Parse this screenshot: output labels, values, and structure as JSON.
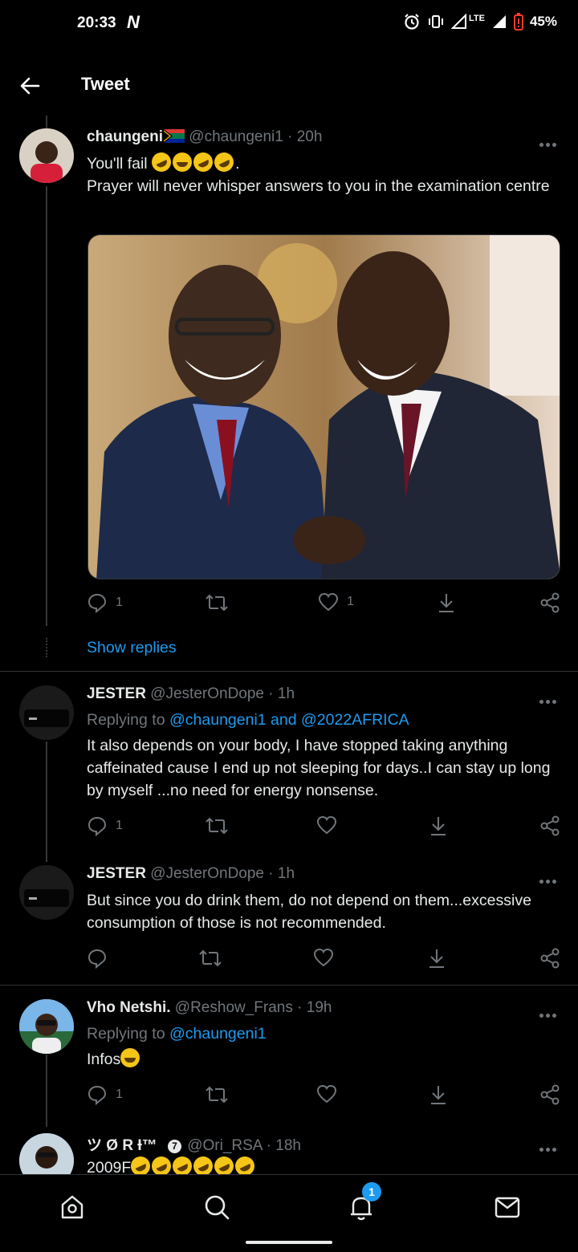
{
  "status_bar": {
    "time": "20:33",
    "carrier_glyph": "N",
    "network": "LTE",
    "battery": "45%"
  },
  "header": {
    "title": "Tweet"
  },
  "tweets": [
    {
      "name": "chaungeni",
      "handle": "@chaungeni1",
      "time": "· 20h",
      "text_line1_prefix": "You'll fail ",
      "text_line1_suffix": ".",
      "text_line2": "Prayer will never whisper answers to you in the examination centre",
      "replies": "1",
      "likes": "1"
    },
    {
      "name": "JESTER",
      "handle": "@JesterOnDope",
      "time": "· 1h",
      "replying_prefix": "Replying to ",
      "replying_to": "@chaungeni1 and @2022AFRICA",
      "text": "It also depends on your body, I have stopped taking anything caffeinated cause  I end up not sleeping for days..I can stay up long by myself ...no need for energy nonsense.",
      "replies": "1"
    },
    {
      "name": "JESTER",
      "handle": "@JesterOnDope",
      "time": "· 1h",
      "text": "But since you do drink them, do not depend on them...excessive consumption of those is not recommended."
    },
    {
      "name": "Vho Netshi.",
      "handle": "@Reshow_Frans",
      "time": "· 19h",
      "replying_prefix": "Replying to ",
      "replying_to": "@chaungeni1",
      "text": "Infos",
      "replies": "1"
    },
    {
      "name": "ツ Ø R Ɨ™",
      "verified_badge": "7",
      "handle": "@Ori_RSA",
      "time": "· 18h",
      "text": "2009F"
    }
  ],
  "show_replies": "Show replies",
  "bottom_nav": {
    "notifications_badge": "1"
  }
}
